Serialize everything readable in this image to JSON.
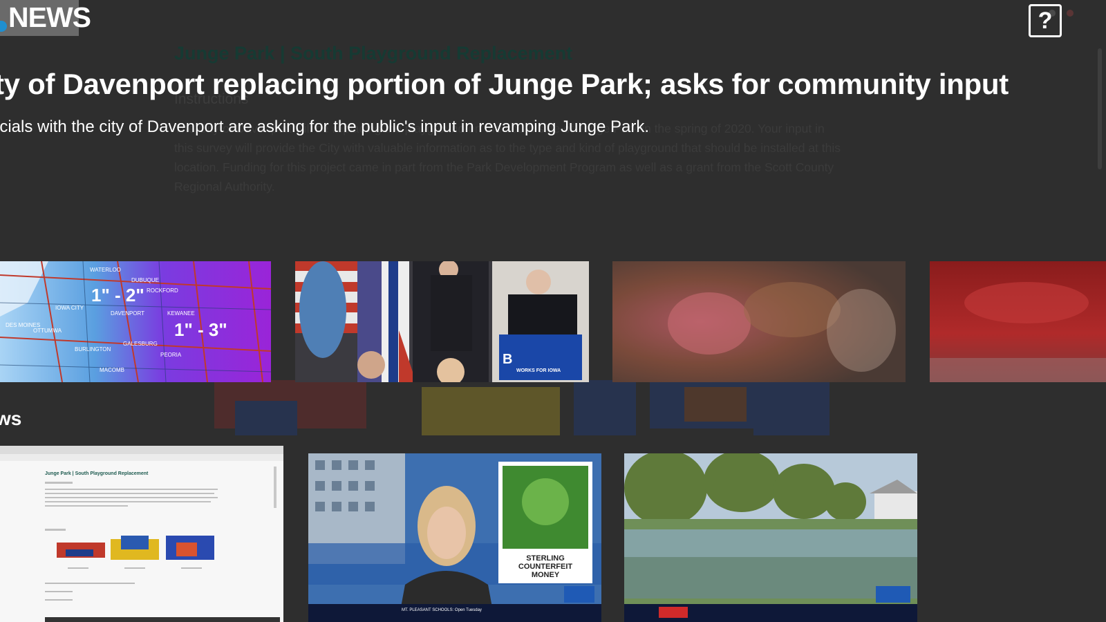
{
  "background_page": {
    "title": "Junge Park | South Playground Replacement",
    "instructions_heading": "Instructions",
    "paragraph": "The City of Davenport will be replacing the playground on the south side of Junge Park in the spring of 2020. Your input in this survey will provide the City with valuable information as to the type and kind of playground that should be installed at this location. Funding for this project came in part from the Park Development Program as well as a grant from the Scott County Regional Authority."
  },
  "logo": {
    "text": "NEWS",
    "icon": "peacock-icon"
  },
  "help_button": {
    "label": "?",
    "icon": "question-icon"
  },
  "article": {
    "headline": "ty of Davenport replacing portion of Junge Park; asks for community input",
    "summary": "icials with the city of Davenport are asking for the public's input in revamping Junge Park."
  },
  "top_row": [
    {
      "name": "snow-forecast-map",
      "labels": [
        "1\" - 2\"",
        "1\" - 3\""
      ],
      "cities": [
        "WATERLOO",
        "DUBUQUE",
        "ROCKFORD",
        "IOWA CITY",
        "DAVENPORT",
        "KEWANEE",
        "PEORIA",
        "MACOMB",
        "GALESBURG",
        "BURLINGTON",
        "OTTUMWA",
        "DES MOINES"
      ]
    },
    {
      "name": "campaign-rally",
      "podium_text": "WORKS FOR IOWA"
    },
    {
      "name": "blurred-video-1"
    },
    {
      "name": "blurred-video-2"
    }
  ],
  "section": {
    "title": "ws"
  },
  "bottom_row": [
    {
      "name": "survey-screenshot",
      "title": "Junge Park | South Playground Replacement"
    },
    {
      "name": "anchor-counterfeit-money",
      "graphic_text": [
        "STERLING",
        "COUNTERFEIT",
        "MONEY"
      ],
      "ticker": "MT. PLEASANT SCHOOLS: Open Tuesday"
    },
    {
      "name": "flooded-neighborhood"
    }
  ],
  "colors": {
    "background": "#2e2e2e",
    "text": "#ffffff",
    "map_purple": "#8a2be2",
    "map_blue": "#4a90d9"
  }
}
